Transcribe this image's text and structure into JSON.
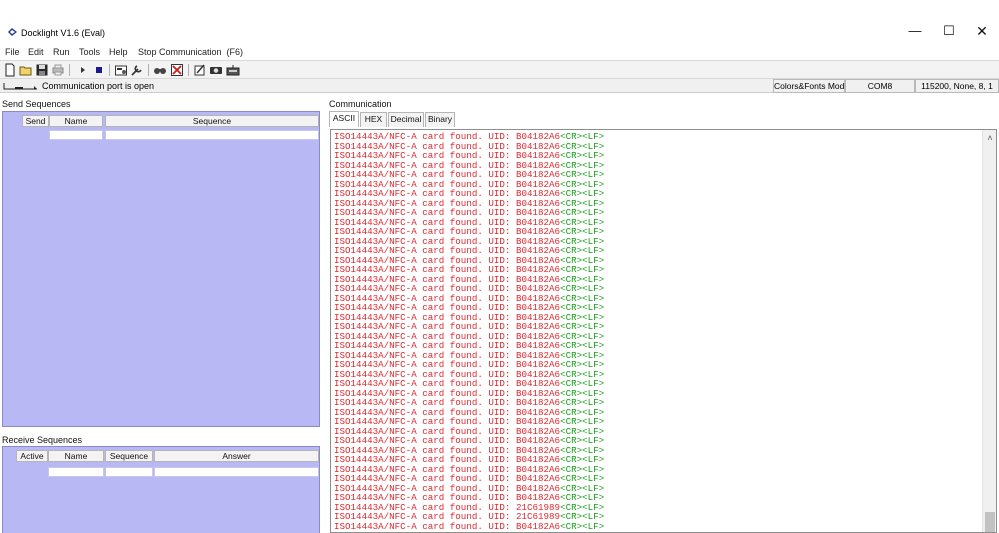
{
  "window": {
    "title": "Docklight V1.6 (Eval)",
    "min_glyph": "—",
    "max_glyph": "☐",
    "close_glyph": "✕"
  },
  "menu": {
    "file": "File",
    "edit": "Edit",
    "run": "Run",
    "tools": "Tools",
    "help": "Help",
    "stop_communication": "Stop Communication  (F6)"
  },
  "toolbar": {
    "icons": [
      "new-file-icon",
      "open-folder-icon",
      "save-icon",
      "print-icon",
      "play-icon",
      "stop-icon",
      "settings-icon",
      "tools-icon",
      "find-icon",
      "clear-icon",
      "script-icon",
      "snapshot-icon",
      "keyboard-icon"
    ]
  },
  "status": {
    "port_status": "Communication port is open",
    "colors_fonts_mode": "Colors&Fonts Mode",
    "com_port": "COM8",
    "port_settings": "115200, None, 8, 1"
  },
  "send_sequences": {
    "title": "Send Sequences",
    "columns": [
      "Send",
      "Name",
      "Sequence"
    ]
  },
  "receive_sequences": {
    "title": "Receive Sequences",
    "columns": [
      "Active",
      "Name",
      "Sequence",
      "Answer"
    ]
  },
  "communication": {
    "title": "Communication",
    "tabs": [
      "ASCII",
      "HEX",
      "Decimal",
      "Binary"
    ],
    "active_tab": "ASCII",
    "lines": [
      {
        "text": "ISO14443A/NFC-A card found. UID: B04182A6",
        "crlf": "<CR><LF>"
      },
      {
        "text": "ISO14443A/NFC-A card found. UID: B04182A6",
        "crlf": "<CR><LF>"
      },
      {
        "text": "ISO14443A/NFC-A card found. UID: B04182A6",
        "crlf": "<CR><LF>"
      },
      {
        "text": "ISO14443A/NFC-A card found. UID: B04182A6",
        "crlf": "<CR><LF>"
      },
      {
        "text": "ISO14443A/NFC-A card found. UID: B04182A6",
        "crlf": "<CR><LF>"
      },
      {
        "text": "ISO14443A/NFC-A card found. UID: B04182A6",
        "crlf": "<CR><LF>"
      },
      {
        "text": "ISO14443A/NFC-A card found. UID: B04182A6",
        "crlf": "<CR><LF>"
      },
      {
        "text": "ISO14443A/NFC-A card found. UID: B04182A6",
        "crlf": "<CR><LF>"
      },
      {
        "text": "ISO14443A/NFC-A card found. UID: B04182A6",
        "crlf": "<CR><LF>"
      },
      {
        "text": "ISO14443A/NFC-A card found. UID: B04182A6",
        "crlf": "<CR><LF>"
      },
      {
        "text": "ISO14443A/NFC-A card found. UID: B04182A6",
        "crlf": "<CR><LF>"
      },
      {
        "text": "ISO14443A/NFC-A card found. UID: B04182A6",
        "crlf": "<CR><LF>"
      },
      {
        "text": "ISO14443A/NFC-A card found. UID: B04182A6",
        "crlf": "<CR><LF>"
      },
      {
        "text": "ISO14443A/NFC-A card found. UID: B04182A6",
        "crlf": "<CR><LF>"
      },
      {
        "text": "ISO14443A/NFC-A card found. UID: B04182A6",
        "crlf": "<CR><LF>"
      },
      {
        "text": "ISO14443A/NFC-A card found. UID: B04182A6",
        "crlf": "<CR><LF>"
      },
      {
        "text": "ISO14443A/NFC-A card found. UID: B04182A6",
        "crlf": "<CR><LF>"
      },
      {
        "text": "ISO14443A/NFC-A card found. UID: B04182A6",
        "crlf": "<CR><LF>"
      },
      {
        "text": "ISO14443A/NFC-A card found. UID: B04182A6",
        "crlf": "<CR><LF>"
      },
      {
        "text": "ISO14443A/NFC-A card found. UID: B04182A6",
        "crlf": "<CR><LF>"
      },
      {
        "text": "ISO14443A/NFC-A card found. UID: B04182A6",
        "crlf": "<CR><LF>"
      },
      {
        "text": "ISO14443A/NFC-A card found. UID: B04182A6",
        "crlf": "<CR><LF>"
      },
      {
        "text": "ISO14443A/NFC-A card found. UID: B04182A6",
        "crlf": "<CR><LF>"
      },
      {
        "text": "ISO14443A/NFC-A card found. UID: B04182A6",
        "crlf": "<CR><LF>"
      },
      {
        "text": "ISO14443A/NFC-A card found. UID: B04182A6",
        "crlf": "<CR><LF>"
      },
      {
        "text": "ISO14443A/NFC-A card found. UID: B04182A6",
        "crlf": "<CR><LF>"
      },
      {
        "text": "ISO14443A/NFC-A card found. UID: B04182A6",
        "crlf": "<CR><LF>"
      },
      {
        "text": "ISO14443A/NFC-A card found. UID: B04182A6",
        "crlf": "<CR><LF>"
      },
      {
        "text": "ISO14443A/NFC-A card found. UID: B04182A6",
        "crlf": "<CR><LF>"
      },
      {
        "text": "ISO14443A/NFC-A card found. UID: B04182A6",
        "crlf": "<CR><LF>"
      },
      {
        "text": "ISO14443A/NFC-A card found. UID: B04182A6",
        "crlf": "<CR><LF>"
      },
      {
        "text": "ISO14443A/NFC-A card found. UID: B04182A6",
        "crlf": "<CR><LF>"
      },
      {
        "text": "ISO14443A/NFC-A card found. UID: B04182A6",
        "crlf": "<CR><LF>"
      },
      {
        "text": "ISO14443A/NFC-A card found. UID: B04182A6",
        "crlf": "<CR><LF>"
      },
      {
        "text": "ISO14443A/NFC-A card found. UID: B04182A6",
        "crlf": "<CR><LF>"
      },
      {
        "text": "ISO14443A/NFC-A card found. UID: B04182A6",
        "crlf": "<CR><LF>"
      },
      {
        "text": "ISO14443A/NFC-A card found. UID: B04182A6",
        "crlf": "<CR><LF>"
      },
      {
        "text": "ISO14443A/NFC-A card found. UID: B04182A6",
        "crlf": "<CR><LF>"
      },
      {
        "text": "ISO14443A/NFC-A card found. UID: B04182A6",
        "crlf": "<CR><LF>"
      },
      {
        "text": "ISO14443A/NFC-A card found. UID: 21C61989",
        "crlf": "<CR><LF>"
      },
      {
        "text": "ISO14443A/NFC-A card found. UID: 21C61989",
        "crlf": "<CR><LF>"
      },
      {
        "text": "ISO14443A/NFC-A card found. UID: B04182A6",
        "crlf": "<CR><LF>"
      }
    ]
  }
}
